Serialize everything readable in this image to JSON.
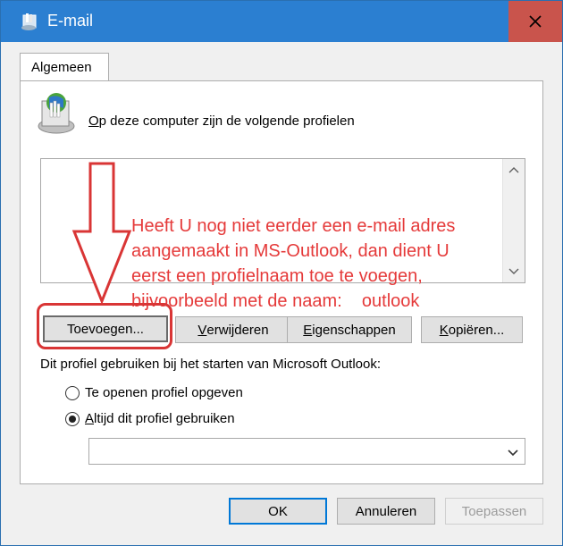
{
  "window": {
    "title": "E-mail",
    "close_symbol": "✕",
    "colors": {
      "titlebar": "#2b7fd1",
      "close": "#c9544c",
      "annotation": "#e53a3a"
    }
  },
  "tabs": [
    {
      "label": "Algemeen",
      "active": true
    }
  ],
  "panel": {
    "profiles_label_first": "O",
    "profiles_label_rest": "p deze computer zijn de volgende profielen",
    "profiles_list": [],
    "annotation_lines": [
      "Heeft U nog niet eerder een e-mail adres",
      "aangemaakt in MS-Outlook, dan dient U",
      "eerst een profielnaam toe te voegen,",
      "bijvoorbeeld met de naam:    outlook"
    ],
    "buttons": {
      "add": "Toevoegen...",
      "remove_first": "V",
      "remove_rest": "erwijderen",
      "properties_first": "E",
      "properties_rest": "igenschappen",
      "copy_first": "K",
      "copy_rest": "opiëren..."
    },
    "usage_label": "Dit profiel gebruiken bij het starten van Microsoft Outlook:",
    "radio_prompt": "Te openen profiel opgeven",
    "radio_always_first": "A",
    "radio_always_rest": "ltijd dit profiel gebruiken",
    "radio_selected": "always",
    "profile_select_value": ""
  },
  "footer": {
    "ok": "OK",
    "cancel": "Annuleren",
    "apply": "Toepassen"
  },
  "icons": [
    "mail-profile-icon",
    "outlook-profiles-icon",
    "close-icon",
    "scroll-up-icon",
    "scroll-down-icon",
    "dropdown-arrow-icon",
    "red-arrow-annotation"
  ]
}
